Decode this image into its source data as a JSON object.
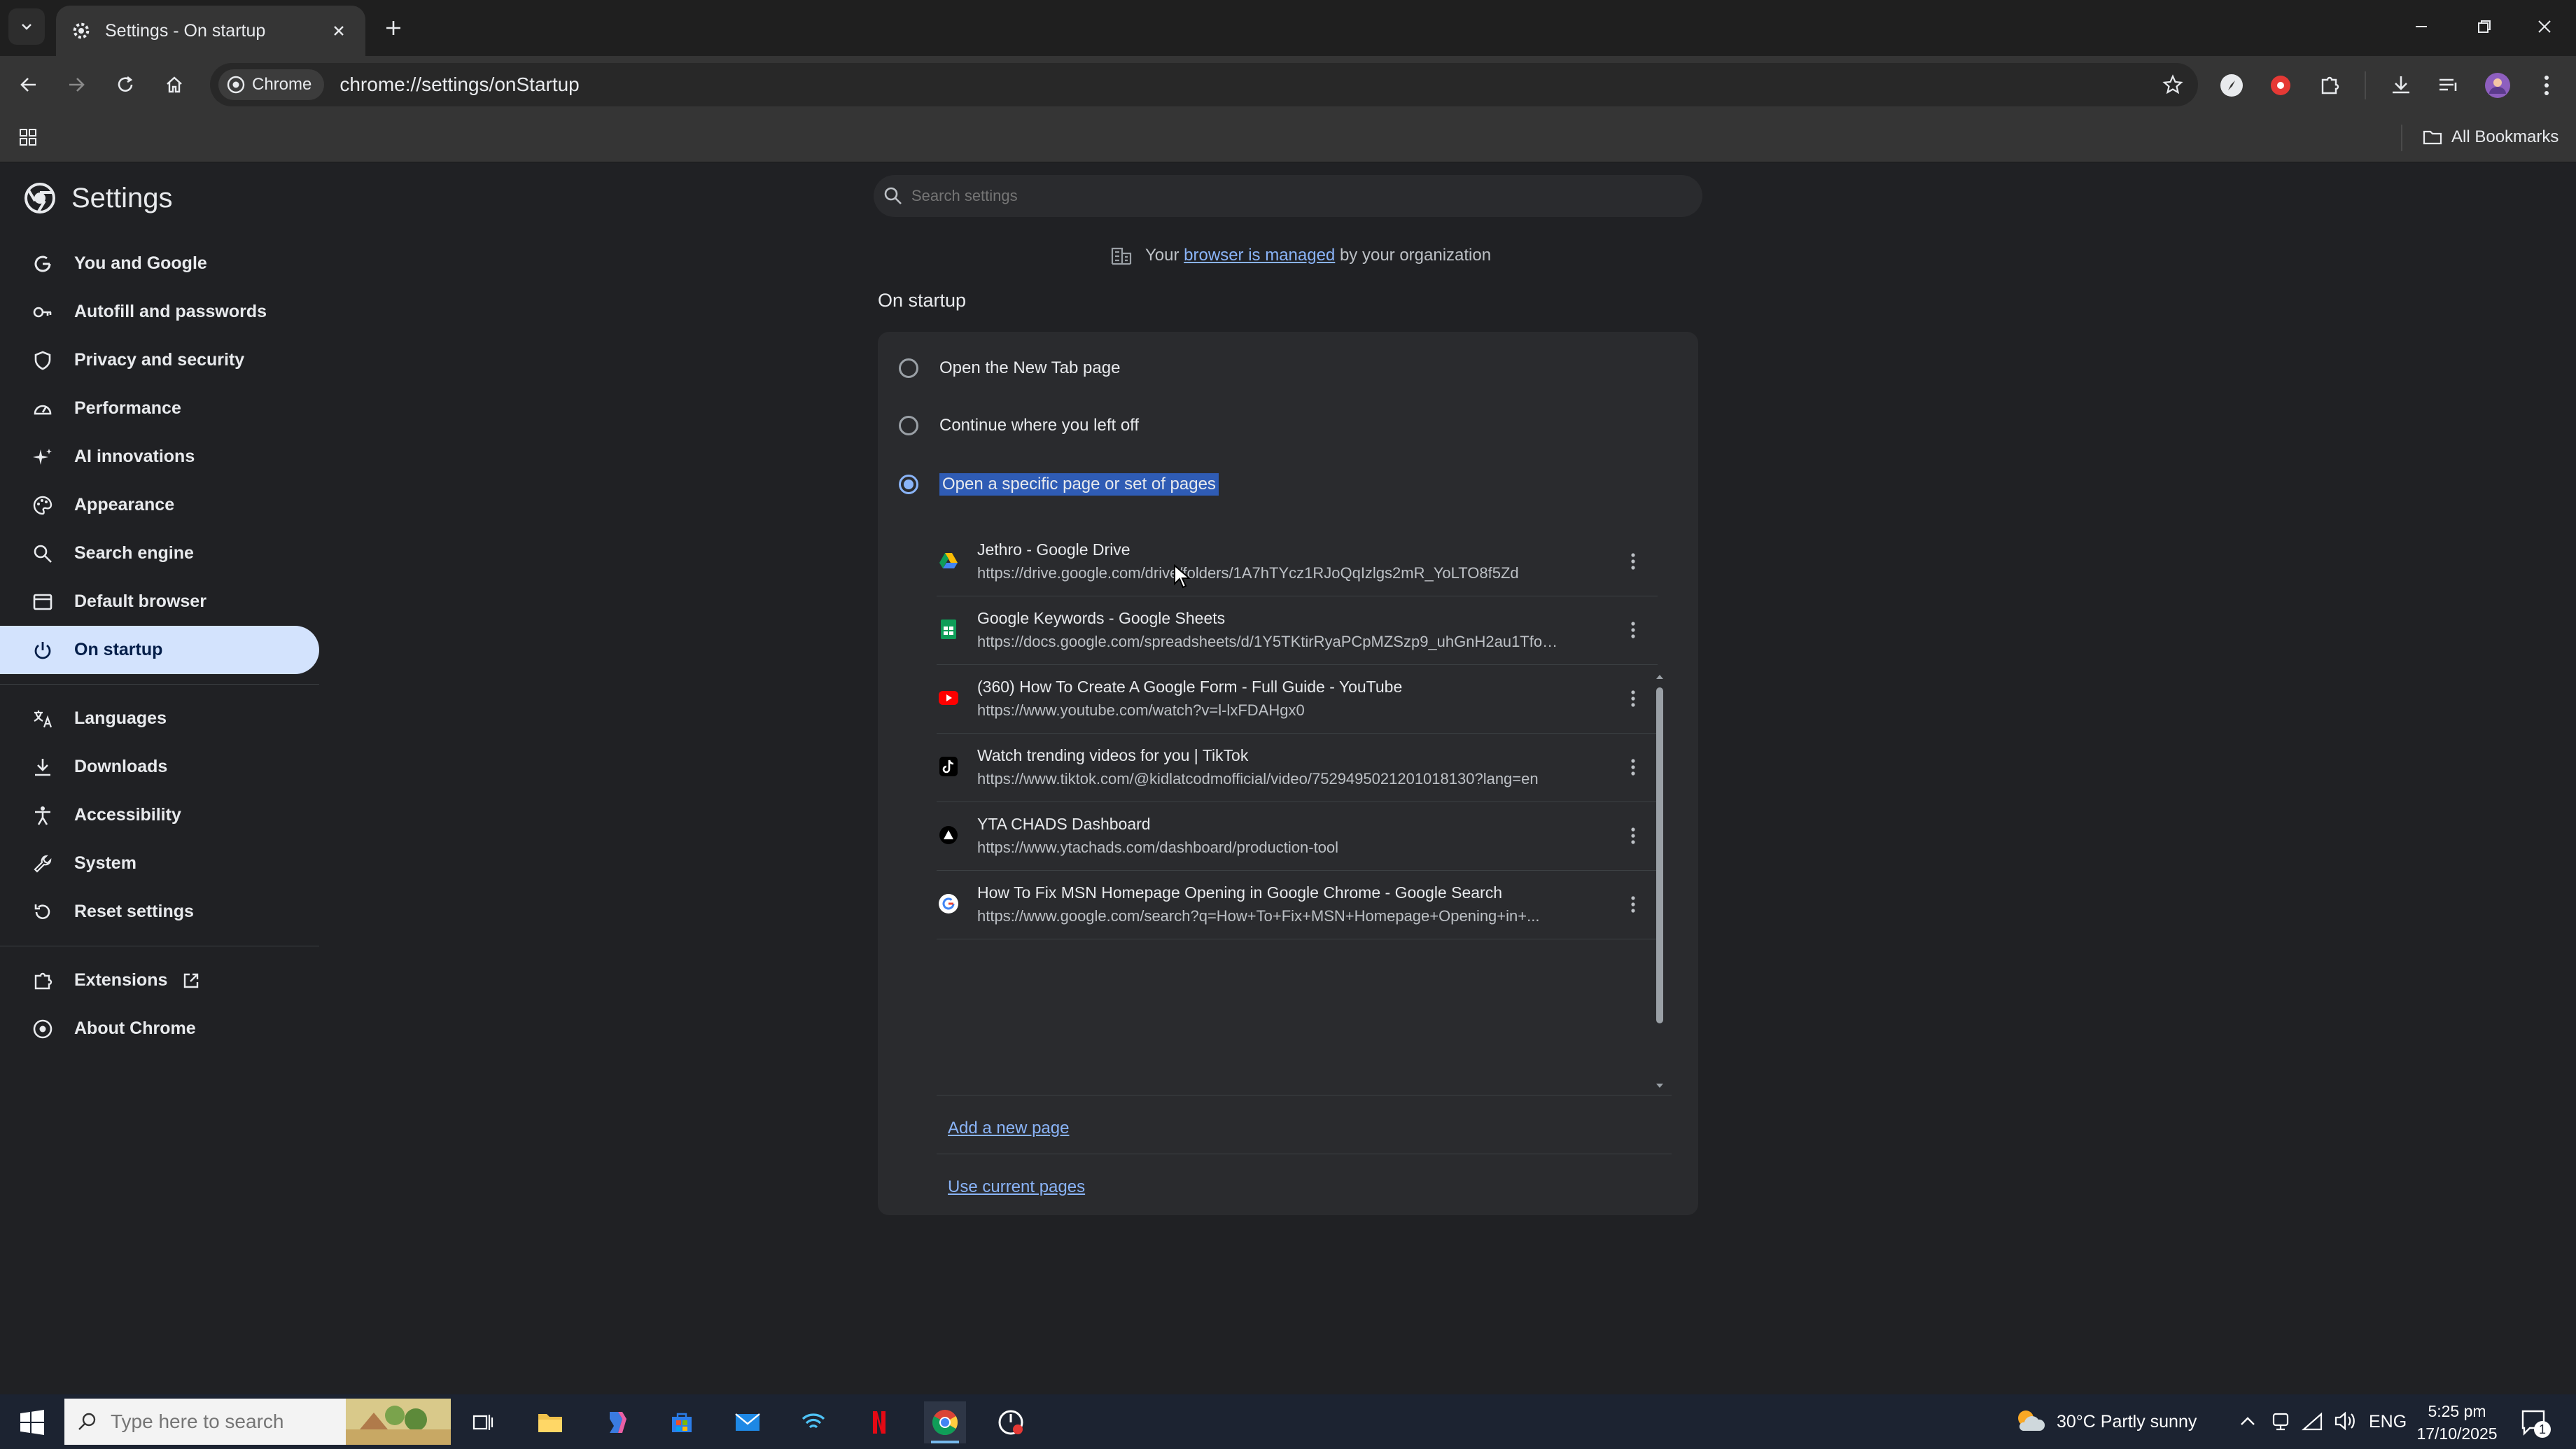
{
  "browser": {
    "tab": {
      "title": "Settings - On startup"
    },
    "omnibox": {
      "chip_label": "Chrome",
      "url": "chrome://settings/onStartup"
    },
    "bookmarks": {
      "all_bookmarks_label": "All Bookmarks"
    }
  },
  "settings": {
    "title": "Settings",
    "search_placeholder": "Search settings",
    "nav": [
      {
        "label": "You and Google",
        "icon": "google-g-icon"
      },
      {
        "label": "Autofill and passwords",
        "icon": "key-icon"
      },
      {
        "label": "Privacy and security",
        "icon": "shield-icon"
      },
      {
        "label": "Performance",
        "icon": "speedometer-icon"
      },
      {
        "label": "AI innovations",
        "icon": "sparkle-icon"
      },
      {
        "label": "Appearance",
        "icon": "palette-icon"
      },
      {
        "label": "Search engine",
        "icon": "search-icon"
      },
      {
        "label": "Default browser",
        "icon": "browser-window-icon"
      },
      {
        "label": "On startup",
        "icon": "power-icon",
        "active": true
      },
      {
        "label": "Languages",
        "icon": "translate-icon"
      },
      {
        "label": "Downloads",
        "icon": "download-icon"
      },
      {
        "label": "Accessibility",
        "icon": "accessibility-icon"
      },
      {
        "label": "System",
        "icon": "wrench-icon"
      },
      {
        "label": "Reset settings",
        "icon": "reset-icon"
      },
      {
        "label": "Extensions",
        "icon": "puzzle-icon"
      },
      {
        "label": "About Chrome",
        "icon": "chrome-icon"
      }
    ],
    "managed_notice": {
      "prefix": "Your",
      "link": "browser is managed",
      "suffix": "by your organization"
    },
    "section_title": "On startup",
    "options": [
      {
        "label": "Open the New Tab page",
        "checked": false
      },
      {
        "label": "Continue where you left off",
        "checked": false
      },
      {
        "label": "Open a specific page or set of pages",
        "checked": true
      }
    ],
    "pages": [
      {
        "title": "Jethro - Google Drive",
        "url": "https://drive.google.com/drive/folders/1A7hTYcz1RJoQqIzlgs2mR_YoLTO8f5Zd",
        "icon": "google-drive-icon"
      },
      {
        "title": "Google Keywords - Google Sheets",
        "url": "https://docs.google.com/spreadsheets/d/1Y5TKtirRyaPCpMZSzp9_uhGnH2au1TfoQ...",
        "icon": "google-sheets-icon"
      },
      {
        "title": "(360) How To Create A Google Form - Full Guide - YouTube",
        "url": "https://www.youtube.com/watch?v=l-lxFDAHgx0",
        "icon": "youtube-icon"
      },
      {
        "title": "Watch trending videos for you | TikTok",
        "url": "https://www.tiktok.com/@kidlatcodmofficial/video/7529495021201018130?lang=en",
        "icon": "tiktok-icon"
      },
      {
        "title": "YTA CHADS Dashboard",
        "url": "https://www.ytachads.com/dashboard/production-tool",
        "icon": "triangle-logo-icon"
      },
      {
        "title": "How To Fix MSN Homepage Opening in Google Chrome - Google Search",
        "url": "https://www.google.com/search?q=How+To+Fix+MSN+Homepage+Opening+in+...",
        "icon": "google-icon"
      }
    ],
    "add_page_label": "Add a new page",
    "use_current_label": "Use current pages"
  },
  "taskbar": {
    "search_placeholder": "Type here to search",
    "weather": "30°C  Partly sunny",
    "language": "ENG",
    "time": "5:25 pm",
    "date": "17/10/2025",
    "notification_count": "1"
  },
  "colors": {
    "accent": "#8ab4f8",
    "active_nav_bg": "#d3e3fd",
    "page_bg": "#202124",
    "card_bg": "#2a2b2e"
  }
}
